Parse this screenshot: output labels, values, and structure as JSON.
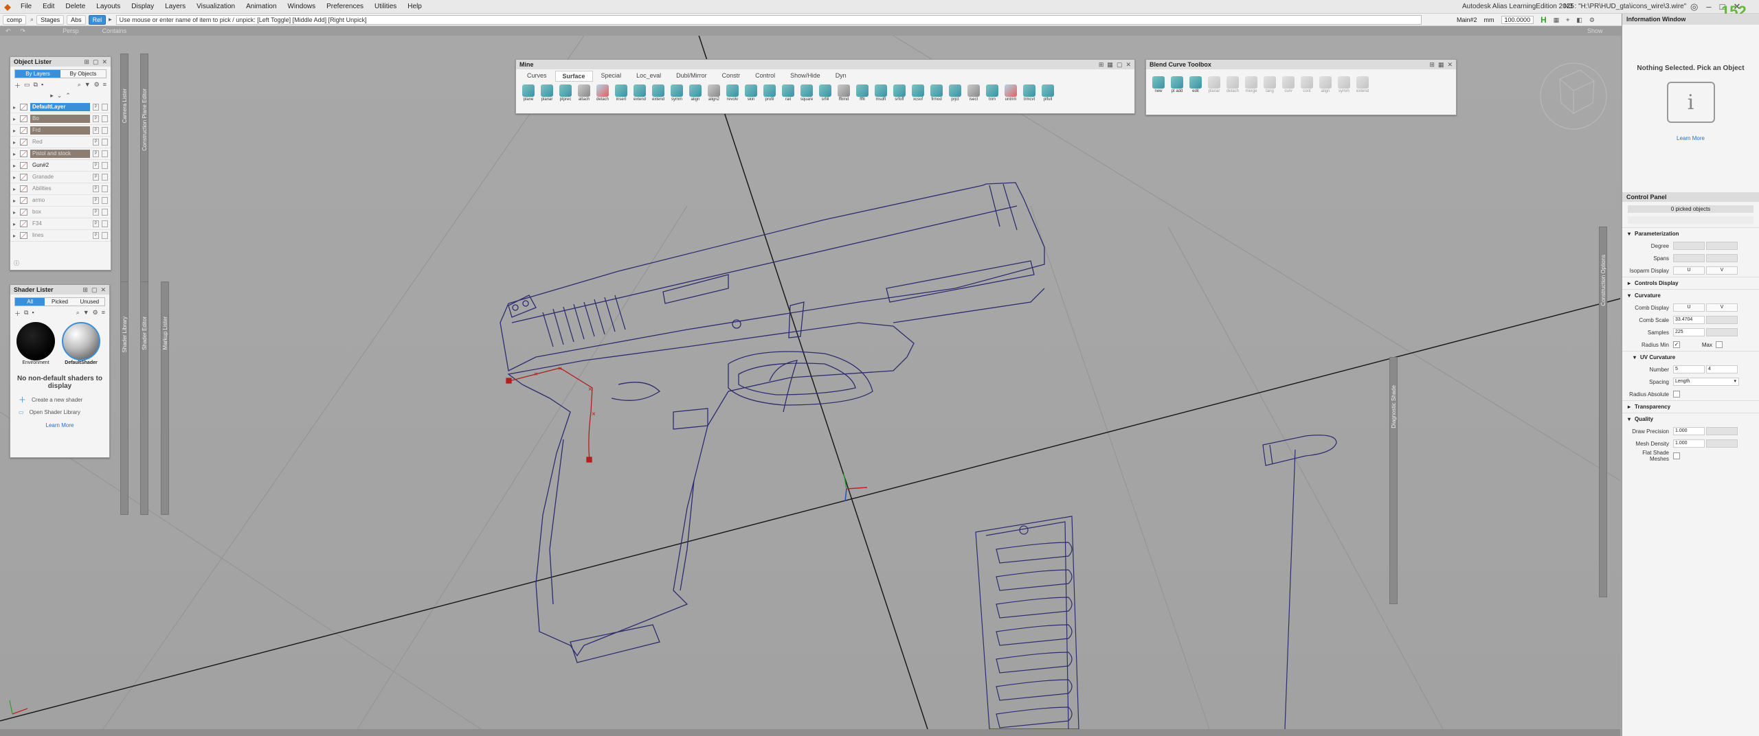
{
  "menubar": {
    "items": [
      "File",
      "Edit",
      "Delete",
      "Layouts",
      "Display",
      "Layers",
      "Visualization",
      "Animation",
      "Windows",
      "Preferences",
      "Utilities",
      "Help"
    ],
    "app_title": "Autodesk Alias LearningEdition 2025",
    "file_path": "N3 : \"H:\\PR\\HUD_gta\\icons_wire\\3.wire\""
  },
  "toolbar": {
    "comp_label": "comp",
    "stages_label": "Stages",
    "abs_label": "Abs",
    "rel_label": "Rel",
    "prompt": "Use mouse or enter name of item to pick / unpick: [Left Toggle] [Middle Add] [Right Unpick]",
    "window_name": "Main#2",
    "unit": "mm",
    "tolerance": "100.0000",
    "h_badge": "H"
  },
  "subbar": {
    "items": [
      "Persp",
      "Contains"
    ],
    "right": "Show"
  },
  "corner_badge": "152",
  "object_lister": {
    "title": "Object Lister",
    "tabs": [
      "By Layers",
      "By Objects"
    ],
    "active_tab": "By Layers",
    "layers": [
      {
        "name": "DefaultLayer",
        "state": "selected"
      },
      {
        "name": "Bo",
        "state": "highlight"
      },
      {
        "name": "Frd",
        "state": "highlight"
      },
      {
        "name": "Red",
        "state": "normal"
      },
      {
        "name": "Pistol and stock",
        "state": "highlight"
      },
      {
        "name": "Gun#2",
        "state": "dark"
      },
      {
        "name": "Granade",
        "state": "normal"
      },
      {
        "name": "Abilities",
        "state": "normal"
      },
      {
        "name": "armo",
        "state": "normal"
      },
      {
        "name": "box",
        "state": "normal"
      },
      {
        "name": "F34",
        "state": "normal"
      },
      {
        "name": "lines",
        "state": "normal"
      }
    ]
  },
  "shader_lister": {
    "title": "Shader Lister",
    "tabs": [
      "All",
      "Picked",
      "Unused"
    ],
    "active_tab": "All",
    "shaders": [
      "Environment",
      "DefaultShader"
    ],
    "empty_message": "No non-default shaders to display",
    "create_label": "Create a new shader",
    "open_label": "Open Shader Library",
    "learn_more": "Learn More"
  },
  "side_strips": {
    "cameras": "Camera Lister",
    "construction": "Construction Plane Editor",
    "shader_library": "Shader Library",
    "shader_editor": "Shader Editor",
    "markup": "Markup Lister",
    "construction_options": "Construction Options",
    "diagnostic": "Diagnostic Shade"
  },
  "shelf_mine": {
    "title": "Mine",
    "tabs": [
      "Curves",
      "Surface",
      "Special",
      "Loc_eval",
      "Dubl/Mirror",
      "Constr",
      "Control",
      "Show/Hide",
      "Dyn"
    ],
    "active_tab": "Surface",
    "tools": [
      "plane",
      "planar",
      "ptprec",
      "attach",
      "detach",
      "insert",
      "extend",
      "extend",
      "symm",
      "align",
      "align2",
      "revolv",
      "skin",
      "profil",
      "rail",
      "square",
      "srfill",
      "ffblnd",
      "ffflt",
      "msdft",
      "srfoff",
      "xcsof",
      "frmod",
      "prjct",
      "isect",
      "trim",
      "untrim",
      "trmcvt",
      "plfull"
    ]
  },
  "blend_toolbox": {
    "title": "Blend Curve Toolbox",
    "tools": [
      "new",
      "pt add",
      "edit",
      "planar",
      "detach",
      "merge",
      "tang",
      "curv",
      "cont",
      "align",
      "symm",
      "extend"
    ]
  },
  "info_window": {
    "title": "Information Window",
    "message": "Nothing Selected. Pick an Object",
    "learn_more": "Learn More"
  },
  "control_panel": {
    "title": "Control Panel",
    "picked": "0 picked objects",
    "param_header": "Parameterization",
    "degree_label": "Degree",
    "spans_label": "Spans",
    "isoparm_label": "Isoparm Display",
    "u": "U",
    "v": "V",
    "controls_header": "Controls Display",
    "curvature_header": "Curvature",
    "comb_display_label": "Comb Display",
    "comb_scale_label": "Comb Scale",
    "comb_scale_value": "33.4704",
    "samples_label": "Samples",
    "samples_value": "225",
    "radius_min_label": "Radius Min",
    "max_label": "Max",
    "uv_header": "UV Curvature",
    "number_label": "Number",
    "number_u": "5",
    "number_v": "4",
    "spacing_label": "Spacing",
    "spacing_value": "Length",
    "radius_abs_label": "Radius Absolute",
    "transparency_header": "Transparency",
    "quality_header": "Quality",
    "draw_precision_label": "Draw Precision",
    "draw_precision_value": "1.000",
    "mesh_density_label": "Mesh Density",
    "mesh_density_value": "1.000",
    "flat_shade_label": "Flat Shade Meshes"
  },
  "colors": {
    "accent": "#3a8fd8",
    "wire": "#2c2c6e",
    "highlight_curve": "#c02020",
    "viewport": "#a4a4a4"
  }
}
